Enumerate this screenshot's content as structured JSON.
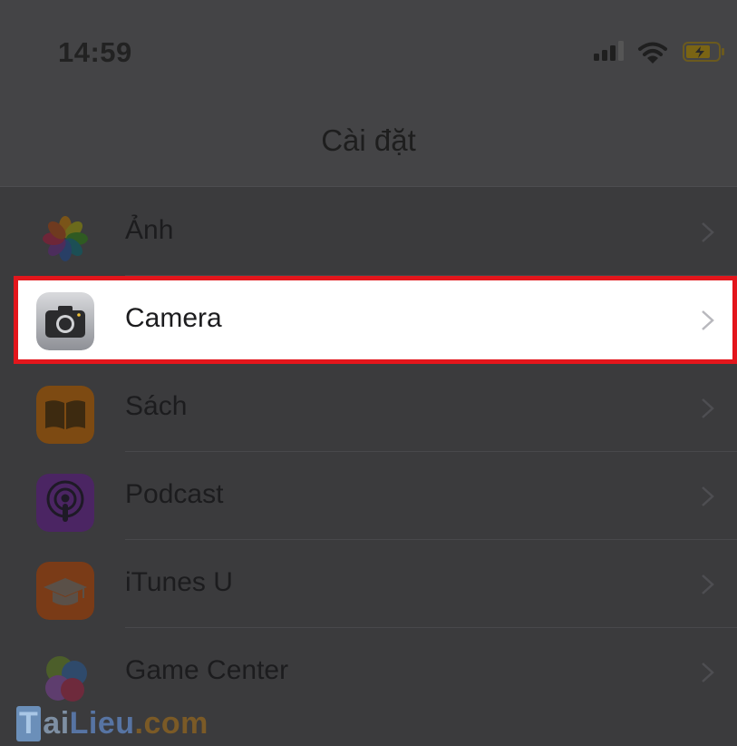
{
  "status_bar": {
    "time": "14:59"
  },
  "nav": {
    "title": "Cài đặt"
  },
  "settings": {
    "items": [
      {
        "label": "Ảnh",
        "icon": "photos-icon"
      },
      {
        "label": "Camera",
        "icon": "camera-icon"
      },
      {
        "label": "Sách",
        "icon": "books-icon"
      },
      {
        "label": "Podcast",
        "icon": "podcasts-icon"
      },
      {
        "label": "iTunes U",
        "icon": "itunes-u-icon"
      },
      {
        "label": "Game Center",
        "icon": "game-center-icon"
      }
    ]
  },
  "watermark": {
    "t": "T",
    "ai": "ai",
    "lieu": "Lieu",
    "com": ".com"
  },
  "colors": {
    "highlight_border": "#e3161c",
    "dim_overlay": "#3b3b3d"
  }
}
